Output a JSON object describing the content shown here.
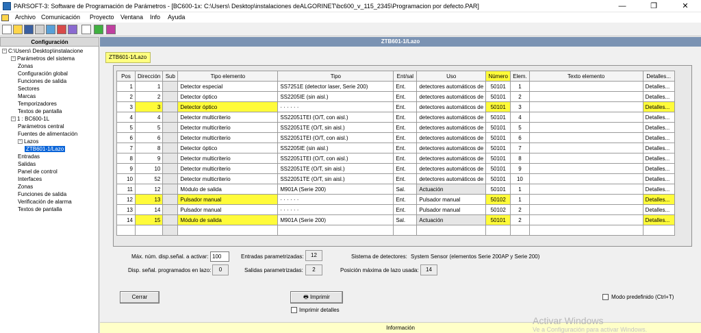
{
  "window": {
    "title": "PARSOFT-3: Software de Programación de Parámetros - [BC600-1x: C:\\Users\\          Desktop\\instalaciones deALGORINET\\bc600_v_115_2345\\Programacion por defecto.PAR]",
    "minimize": "—",
    "restore": "❐",
    "close": "✕"
  },
  "menu": [
    "Archivo",
    "Comunicación",
    "Proyecto",
    "Ventana",
    "Info",
    "Ayuda"
  ],
  "tree": {
    "header": "Configuración",
    "root": "C:\\Users\\          Desktop\\instalacione",
    "items": [
      {
        "label": "Parámetros del sistema",
        "level": 1,
        "expander": "−"
      },
      {
        "label": "Zonas",
        "level": 2
      },
      {
        "label": "Configuración global",
        "level": 2
      },
      {
        "label": "Funciones de salida",
        "level": 2
      },
      {
        "label": "Sectores",
        "level": 2
      },
      {
        "label": "Marcas",
        "level": 2
      },
      {
        "label": "Temporizadores",
        "level": 2
      },
      {
        "label": "Textos de pantalla",
        "level": 2
      },
      {
        "label": "1 : BC600-1L",
        "level": 1,
        "expander": "−"
      },
      {
        "label": "Parámetros central",
        "level": 2
      },
      {
        "label": "Fuentes de alimentación",
        "level": 2
      },
      {
        "label": "Lazos",
        "level": 2,
        "expander": "−"
      },
      {
        "label": "ZTB601-1/Lazo",
        "level": 3,
        "selected": true
      },
      {
        "label": "Entradas",
        "level": 2
      },
      {
        "label": "Salidas",
        "level": 2
      },
      {
        "label": "Panel de control",
        "level": 2
      },
      {
        "label": "Interfaces",
        "level": 2
      },
      {
        "label": "Zonas",
        "level": 2
      },
      {
        "label": "Funciones de salida",
        "level": 2
      },
      {
        "label": "Verificación de alarma",
        "level": 2
      },
      {
        "label": "Textos de pantalla",
        "level": 2
      }
    ]
  },
  "panel": {
    "header": "ZTB601-1/Lazo",
    "tab": "ZTB601-1/Lazo"
  },
  "table": {
    "columns": [
      "Pos",
      "Dirección",
      "Sub",
      "Tipo elemento",
      "Tipo",
      "Ent/sal",
      "Uso",
      "Número",
      "Elem.",
      "Texto elemento",
      "Detalles..."
    ],
    "rows": [
      {
        "pos": "1",
        "dir": "1",
        "sub": "",
        "tipo_elem": "Detector especial",
        "tipo": "SS7251E (detector laser, Serie 200)",
        "es": "Ent.",
        "uso": "detectores automáticos de",
        "num": "50101",
        "elem": "1",
        "texto": "",
        "det": "Detalles...",
        "hl": false
      },
      {
        "pos": "2",
        "dir": "2",
        "sub": "",
        "tipo_elem": "Detector óptico",
        "tipo": "SS2205IE (sin aisl.)",
        "es": "Ent.",
        "uso": "detectores automáticos de",
        "num": "50101",
        "elem": "2",
        "texto": "",
        "det": "Detalles...",
        "hl": false
      },
      {
        "pos": "3",
        "dir": "3",
        "sub": "",
        "tipo_elem": "Detector óptico",
        "tipo": "· · · · · ·",
        "es": "Ent.",
        "uso": "detectores automáticos de",
        "num": "50101",
        "elem": "3",
        "texto": "",
        "det": "Detalles...",
        "hl": true
      },
      {
        "pos": "4",
        "dir": "4",
        "sub": "",
        "tipo_elem": "Detector multicriterio",
        "tipo": "SS22051TEI (O/T, con aisl.)",
        "es": "Ent.",
        "uso": "detectores automáticos de",
        "num": "50101",
        "elem": "4",
        "texto": "",
        "det": "Detalles...",
        "hl": false
      },
      {
        "pos": "5",
        "dir": "5",
        "sub": "",
        "tipo_elem": "Detector multicriterio",
        "tipo": "SS22051TE (O/T, sin aisl.)",
        "es": "Ent.",
        "uso": "detectores automáticos de",
        "num": "50101",
        "elem": "5",
        "texto": "",
        "det": "Detalles...",
        "hl": false
      },
      {
        "pos": "6",
        "dir": "6",
        "sub": "",
        "tipo_elem": "Detector multicriterio",
        "tipo": "SS22051TEI (O/T, con aisl.)",
        "es": "Ent.",
        "uso": "detectores automáticos de",
        "num": "50101",
        "elem": "6",
        "texto": "",
        "det": "Detalles...",
        "hl": false
      },
      {
        "pos": "7",
        "dir": "8",
        "sub": "",
        "tipo_elem": "Detector óptico",
        "tipo": "SS2205IE (sin aisl.)",
        "es": "Ent.",
        "uso": "detectores automáticos de",
        "num": "50101",
        "elem": "7",
        "texto": "",
        "det": "Detalles...",
        "hl": false
      },
      {
        "pos": "8",
        "dir": "9",
        "sub": "",
        "tipo_elem": "Detector multicriterio",
        "tipo": "SS22051TEI (O/T, con aisl.)",
        "es": "Ent.",
        "uso": "detectores automáticos de",
        "num": "50101",
        "elem": "8",
        "texto": "",
        "det": "Detalles...",
        "hl": false
      },
      {
        "pos": "9",
        "dir": "10",
        "sub": "",
        "tipo_elem": "Detector multicriterio",
        "tipo": "SS22051TE (O/T, sin aisl.)",
        "es": "Ent.",
        "uso": "detectores automáticos de",
        "num": "50101",
        "elem": "9",
        "texto": "",
        "det": "Detalles...",
        "hl": false
      },
      {
        "pos": "10",
        "dir": "52",
        "sub": "",
        "tipo_elem": "Detector multicriterio",
        "tipo": "SS22051TE (O/T, sin aisl.)",
        "es": "Ent.",
        "uso": "detectores automáticos de",
        "num": "50101",
        "elem": "10",
        "texto": "",
        "det": "Detalles...",
        "hl": false
      },
      {
        "pos": "11",
        "dir": "12",
        "sub": "",
        "tipo_elem": "Módulo de salida",
        "tipo": "M901A (Serie 200)",
        "es": "Sal.",
        "uso": "Actuación",
        "num": "50101",
        "elem": "1",
        "texto": "",
        "det": "Detalles...",
        "hl": false
      },
      {
        "pos": "12",
        "dir": "13",
        "sub": "",
        "tipo_elem": "Pulsador manual",
        "tipo": "· · · · · ·",
        "es": "Ent.",
        "uso": "Pulsador manual",
        "num": "50102",
        "elem": "1",
        "texto": "",
        "det": "Detalles...",
        "hl": true
      },
      {
        "pos": "13",
        "dir": "14",
        "sub": "",
        "tipo_elem": "Pulsador manual",
        "tipo": "· · · · · ·",
        "es": "Ent.",
        "uso": "Pulsador manual",
        "num": "50102",
        "elem": "2",
        "texto": "",
        "det": "Detalles...",
        "hl": false
      },
      {
        "pos": "14",
        "dir": "15",
        "sub": "",
        "tipo_elem": "Módulo de salida",
        "tipo": "M901A (Serie 200)",
        "es": "Sal.",
        "uso": "Actuación",
        "num": "50101",
        "elem": "2",
        "texto": "",
        "det": "Detalles...",
        "hl": true
      }
    ]
  },
  "stats": {
    "max_label": "Máx. núm. disp.señal. a activar:",
    "max_value": "100",
    "disp_label": "Disp. señal. programados en lazo:",
    "disp_value": "0",
    "ent_label": "Entradas parametrizadas:",
    "ent_value": "12",
    "sal_label": "Salidas parametrizadas:",
    "sal_value": "2",
    "sistema_label": "Sistema de detectores:",
    "sistema_value": "System Sensor (elementos Serie 200AP y Serie 200)",
    "pos_label": "Posición máxima de lazo usada:",
    "pos_value": "14"
  },
  "buttons": {
    "cerrar": "Cerrar",
    "imprimir": "Imprimir",
    "imprimir_detalles": "Imprimir detalles",
    "modo_predefinido": "Modo predefinido (Ctrl+T)"
  },
  "status": "Información",
  "watermark": {
    "line1": "Activar Windows",
    "line2": "Ve a Configuración para activar Windows."
  },
  "colors": {
    "highlight": "#fffb3a",
    "panel_header": "#7b93b3",
    "selection": "#0a64d8"
  }
}
